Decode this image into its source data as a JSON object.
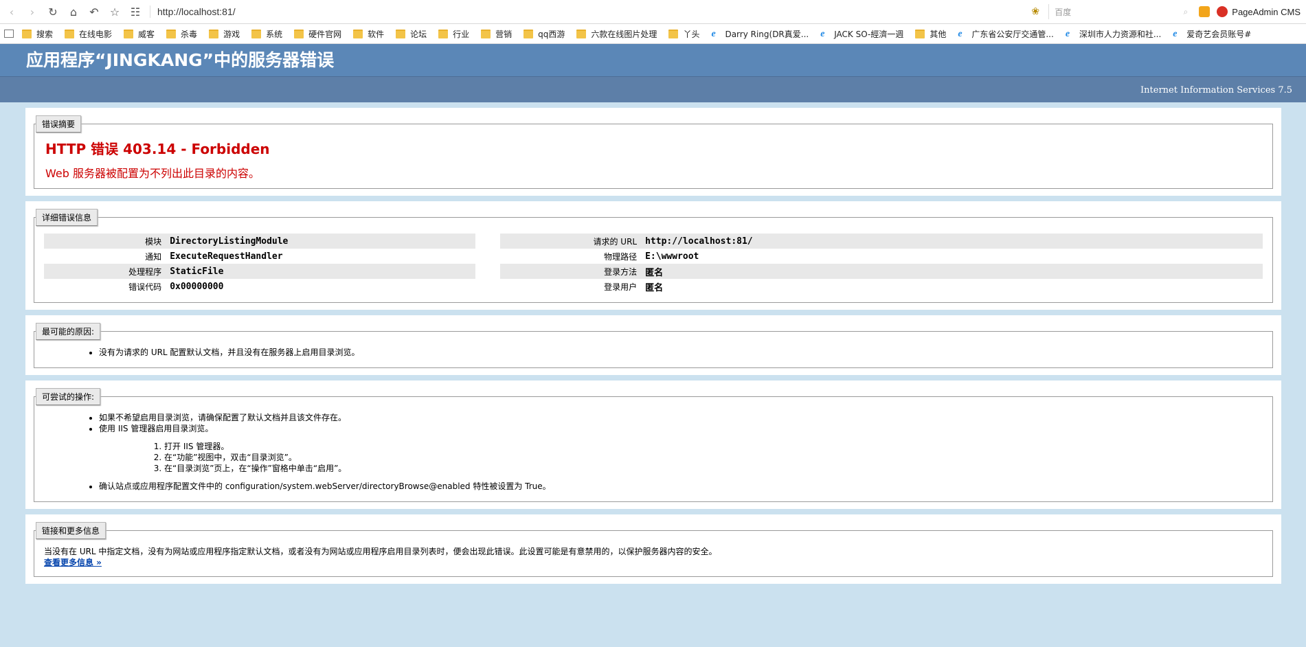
{
  "browser": {
    "url": "http://localhost:81/",
    "search_placeholder": "百度",
    "extension_label": "PageAdmin CMS",
    "bookmarks": [
      {
        "label": "搜索",
        "type": "folder"
      },
      {
        "label": "在线电影",
        "type": "folder"
      },
      {
        "label": "威客",
        "type": "folder"
      },
      {
        "label": "杀毒",
        "type": "folder"
      },
      {
        "label": "游戏",
        "type": "folder"
      },
      {
        "label": "系统",
        "type": "folder"
      },
      {
        "label": "硬件官网",
        "type": "folder"
      },
      {
        "label": "软件",
        "type": "folder"
      },
      {
        "label": "论坛",
        "type": "folder"
      },
      {
        "label": "行业",
        "type": "folder"
      },
      {
        "label": "营销",
        "type": "folder"
      },
      {
        "label": "qq西游",
        "type": "folder"
      },
      {
        "label": "六款在线图片处理",
        "type": "folder"
      },
      {
        "label": "丫头",
        "type": "folder"
      },
      {
        "label": "Darry Ring(DR真爱...",
        "type": "ie"
      },
      {
        "label": "JACK SO-經濟一週",
        "type": "ie"
      },
      {
        "label": "其他",
        "type": "folder"
      },
      {
        "label": "广东省公安厅交通管...",
        "type": "ie"
      },
      {
        "label": "深圳市人力资源和社...",
        "type": "ie"
      },
      {
        "label": "爱奇艺会员账号#",
        "type": "ie"
      }
    ]
  },
  "header": {
    "title": "应用程序“JINGKANG”中的服务器错误",
    "server": "Internet Information Services 7.5"
  },
  "summary": {
    "legend": "错误摘要",
    "title": "HTTP 错误 403.14 - Forbidden",
    "message": "Web 服务器被配置为不列出此目录的内容。"
  },
  "details": {
    "legend": "详细错误信息",
    "left": [
      {
        "key": "模块",
        "value": "DirectoryListingModule"
      },
      {
        "key": "通知",
        "value": "ExecuteRequestHandler"
      },
      {
        "key": "处理程序",
        "value": "StaticFile"
      },
      {
        "key": "错误代码",
        "value": "0x00000000"
      }
    ],
    "right": [
      {
        "key": "请求的 URL",
        "value": "http://localhost:81/"
      },
      {
        "key": "物理路径",
        "value": "E:\\wwwroot"
      },
      {
        "key": "登录方法",
        "value": "匿名"
      },
      {
        "key": "登录用户",
        "value": "匿名"
      }
    ]
  },
  "cause": {
    "legend": "最可能的原因:",
    "items": [
      "没有为请求的 URL 配置默认文档，并且没有在服务器上启用目录浏览。"
    ]
  },
  "actions": {
    "legend": "可尝试的操作:",
    "item1": "如果不希望启用目录浏览，请确保配置了默认文档并且该文件存在。",
    "item2": "使用 IIS 管理器启用目录浏览。",
    "steps": [
      "打开 IIS 管理器。",
      "在“功能”视图中，双击“目录浏览”。",
      "在“目录浏览”页上，在“操作”窗格中单击“启用”。"
    ],
    "item3": "确认站点或应用程序配置文件中的 configuration/system.webServer/directoryBrowse@enabled 特性被设置为 True。"
  },
  "links": {
    "legend": "链接和更多信息",
    "text": "当没有在 URL 中指定文档，没有为网站或应用程序指定默认文档，或者没有为网站或应用程序启用目录列表时，便会出现此错误。此设置可能是有意禁用的，以保护服务器内容的安全。",
    "more": "查看更多信息 »"
  }
}
